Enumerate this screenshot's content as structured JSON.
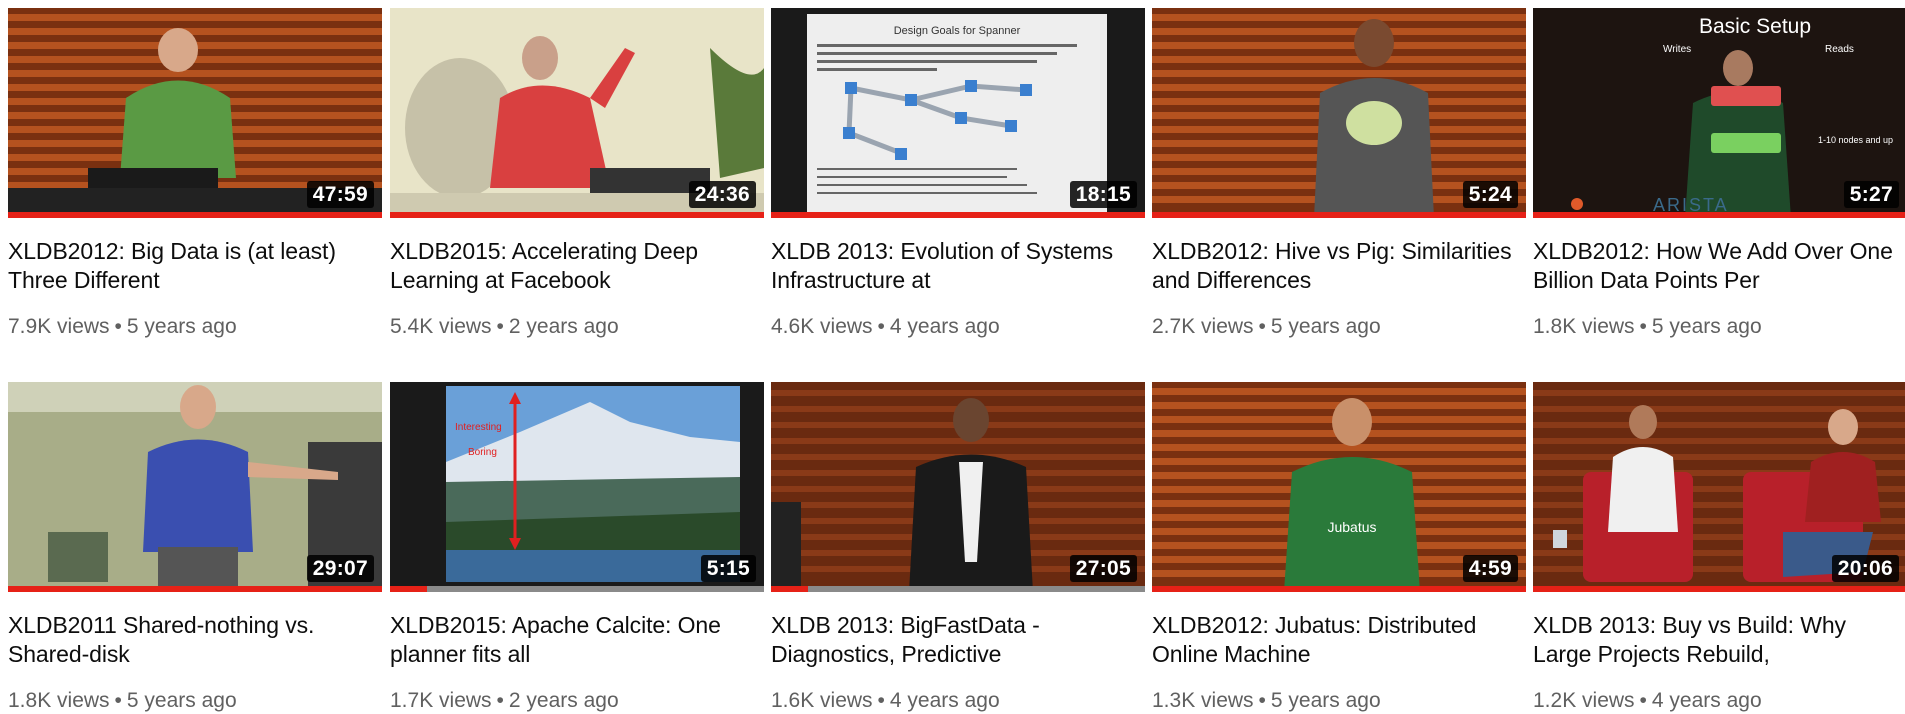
{
  "videos": [
    {
      "title": "XLDB2012: Big Data is (at least) Three Different",
      "duration": "47:59",
      "views": "7.9K views",
      "age": "5 years ago"
    },
    {
      "title": "XLDB2015: Accelerating Deep Learning at Facebook",
      "duration": "24:36",
      "views": "5.4K views",
      "age": "2 years ago"
    },
    {
      "title": "XLDB 2013: Evolution of Systems Infrastructure at",
      "duration": "18:15",
      "views": "4.6K views",
      "age": "4 years ago",
      "slide_title": "Design Goals for Spanner"
    },
    {
      "title": "XLDB2012: Hive vs Pig: Similarities and Differences",
      "duration": "5:24",
      "views": "2.7K views",
      "age": "5 years ago"
    },
    {
      "title": "XLDB2012: How We Add Over One Billion Data Points Per",
      "duration": "5:27",
      "views": "1.8K views",
      "age": "5 years ago",
      "slide_title": "Basic Setup",
      "slide_writes": "Writes",
      "slide_reads": "Reads",
      "slide_nodes": "1-10 nodes and up",
      "slide_logo": "ARISTA"
    },
    {
      "title": "XLDB2011 Shared-nothing vs. Shared-disk",
      "duration": "29:07",
      "views": "1.8K views",
      "age": "5 years ago"
    },
    {
      "title": "XLDB2015: Apache Calcite: One planner fits all",
      "duration": "5:15",
      "views": "1.7K views",
      "age": "2 years ago",
      "slide_interesting": "Interesting",
      "slide_boring": "Boring"
    },
    {
      "title": "XLDB 2013: BigFastData - Diagnostics, Predictive",
      "duration": "27:05",
      "views": "1.6K views",
      "age": "4 years ago"
    },
    {
      "title": "XLDB2012: Jubatus: Distributed Online Machine",
      "duration": "4:59",
      "views": "1.3K views",
      "age": "5 years ago",
      "shirt_text": "Jubatus"
    },
    {
      "title": "XLDB 2013: Buy vs Build: Why Large Projects Rebuild,",
      "duration": "20:06",
      "views": "1.2K views",
      "age": "4 years ago"
    }
  ],
  "separator": "•",
  "colors": {
    "progress": "#e62117",
    "title": "#0d0d0d",
    "meta": "#606060",
    "stage_wood": "#a8481e"
  }
}
